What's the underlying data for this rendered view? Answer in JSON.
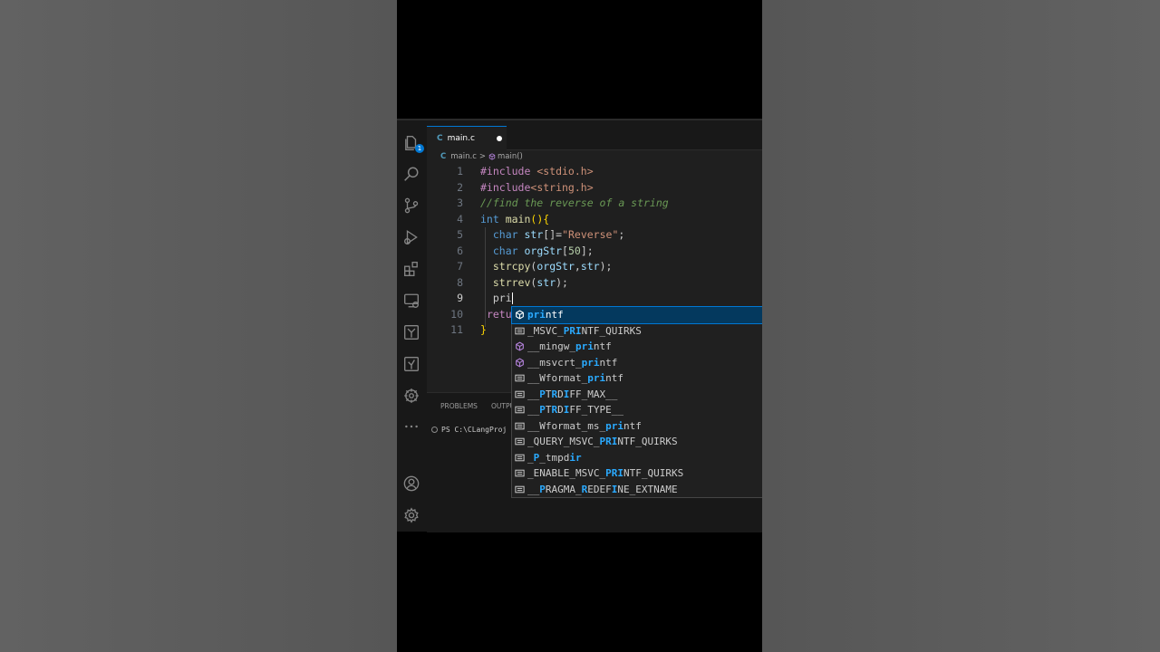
{
  "tab": {
    "lang_badge": "C",
    "title": "main.c",
    "modified": true
  },
  "breadcrumb": {
    "file": "main.c",
    "separator": ">",
    "symbol": "main()"
  },
  "editor": {
    "current_line": 9,
    "lines": [
      {
        "num": "1",
        "tokens": [
          {
            "t": "#include ",
            "c": "k-pre"
          },
          {
            "t": "<stdio.h>",
            "c": "k-str"
          }
        ]
      },
      {
        "num": "2",
        "tokens": [
          {
            "t": "#include",
            "c": "k-pre"
          },
          {
            "t": "<string.h>",
            "c": "k-str"
          }
        ]
      },
      {
        "num": "3",
        "tokens": [
          {
            "t": "//find the reverse of a string",
            "c": "k-com"
          }
        ]
      },
      {
        "num": "4",
        "tokens": [
          {
            "t": "int ",
            "c": "k-kw"
          },
          {
            "t": "main",
            "c": "k-fn"
          },
          {
            "t": "()",
            "c": "k-br"
          },
          {
            "t": "{",
            "c": "k-br"
          }
        ]
      },
      {
        "num": "5",
        "tokens": [
          {
            "t": "  ",
            "c": "k-txt"
          },
          {
            "t": "char ",
            "c": "k-kw"
          },
          {
            "t": "str",
            "c": "k-var"
          },
          {
            "t": "[]",
            "c": "k-txt"
          },
          {
            "t": "=",
            "c": "k-txt"
          },
          {
            "t": "\"Reverse\"",
            "c": "k-str"
          },
          {
            "t": ";",
            "c": "k-txt"
          }
        ]
      },
      {
        "num": "6",
        "tokens": [
          {
            "t": "  ",
            "c": "k-txt"
          },
          {
            "t": "char ",
            "c": "k-kw"
          },
          {
            "t": "orgStr",
            "c": "k-var"
          },
          {
            "t": "[",
            "c": "k-txt"
          },
          {
            "t": "50",
            "c": "k-num"
          },
          {
            "t": "];",
            "c": "k-txt"
          }
        ]
      },
      {
        "num": "7",
        "tokens": [
          {
            "t": "  ",
            "c": "k-txt"
          },
          {
            "t": "strcpy",
            "c": "k-fn"
          },
          {
            "t": "(",
            "c": "k-txt"
          },
          {
            "t": "orgStr",
            "c": "k-var"
          },
          {
            "t": ",",
            "c": "k-txt"
          },
          {
            "t": "str",
            "c": "k-var"
          },
          {
            "t": ");",
            "c": "k-txt"
          }
        ]
      },
      {
        "num": "8",
        "tokens": [
          {
            "t": "  ",
            "c": "k-txt"
          },
          {
            "t": "strrev",
            "c": "k-fn"
          },
          {
            "t": "(",
            "c": "k-txt"
          },
          {
            "t": "str",
            "c": "k-var"
          },
          {
            "t": ");",
            "c": "k-txt"
          }
        ]
      },
      {
        "num": "9",
        "tokens": [
          {
            "t": "  ",
            "c": "k-txt"
          },
          {
            "t": "pri",
            "c": "k-txt"
          }
        ],
        "cursor": true
      },
      {
        "num": "10",
        "tokens": [
          {
            "t": " ",
            "c": "k-txt"
          },
          {
            "t": "retu",
            "c": "k-pre"
          }
        ]
      },
      {
        "num": "11",
        "tokens": [
          {
            "t": "}",
            "c": "k-br"
          }
        ]
      }
    ]
  },
  "panel": {
    "tab_problems": "PROBLEMS",
    "tab_output": "OUTPU",
    "terminal_text": "PS C:\\CLangProj"
  },
  "suggestions": {
    "typed": "pri",
    "items": [
      {
        "pre": "",
        "hl": "pri",
        "post": "ntf",
        "icon": "function-icon",
        "selected": true
      },
      {
        "pre": "_MSVC_",
        "hl": "PRI",
        "post": "NTF_QUIRKS",
        "icon": "constant-icon"
      },
      {
        "pre": "__mingw_",
        "hl": "pri",
        "post": "ntf",
        "icon": "function-icon"
      },
      {
        "pre": "__msvcrt_",
        "hl": "pri",
        "post": "ntf",
        "icon": "function-icon"
      },
      {
        "pre": "__Wformat_",
        "hl": "pri",
        "post": "ntf",
        "icon": "constant-icon"
      },
      {
        "pre": "__",
        "hl": "P",
        "post": "T",
        "hl2": "R",
        "post2": "D",
        "hl3": "I",
        "post3": "FF_MAX__",
        "icon": "constant-icon"
      },
      {
        "pre": "__",
        "hl": "P",
        "post": "T",
        "hl2": "R",
        "post2": "D",
        "hl3": "I",
        "post3": "FF_TYPE__",
        "icon": "constant-icon"
      },
      {
        "pre": "__Wformat_ms_",
        "hl": "pri",
        "post": "ntf",
        "icon": "constant-icon"
      },
      {
        "pre": "_QUERY_MSVC_",
        "hl": "PRI",
        "post": "NTF_QUIRKS",
        "icon": "constant-icon"
      },
      {
        "pre": "_",
        "hl": "P",
        "post": "_tmpd",
        "hl2": "ir",
        "post2": "",
        "icon": "constant-icon"
      },
      {
        "pre": "_ENABLE_MSVC_",
        "hl": "PRI",
        "post": "NTF_QUIRKS",
        "icon": "constant-icon"
      },
      {
        "pre": "__",
        "hl": "P",
        "post": "RAGMA_",
        "hl2": "R",
        "post2": "EDEF",
        "hl3": "I",
        "post3": "NE_EXTNAME",
        "icon": "constant-icon"
      }
    ]
  },
  "activity": {
    "icons": [
      "explorer-icon",
      "search-icon",
      "source-control-icon",
      "run-debug-icon",
      "extensions-icon",
      "remote-explorer-icon",
      "branch-icon",
      "testing-icon",
      "gear-wheel-icon",
      "more-icon",
      "account-icon",
      "manage-icon"
    ],
    "explorer_badge": "1"
  },
  "colors": {
    "accent": "#0078d4",
    "selection": "#04395e",
    "match_highlight": "#2aaaff"
  }
}
